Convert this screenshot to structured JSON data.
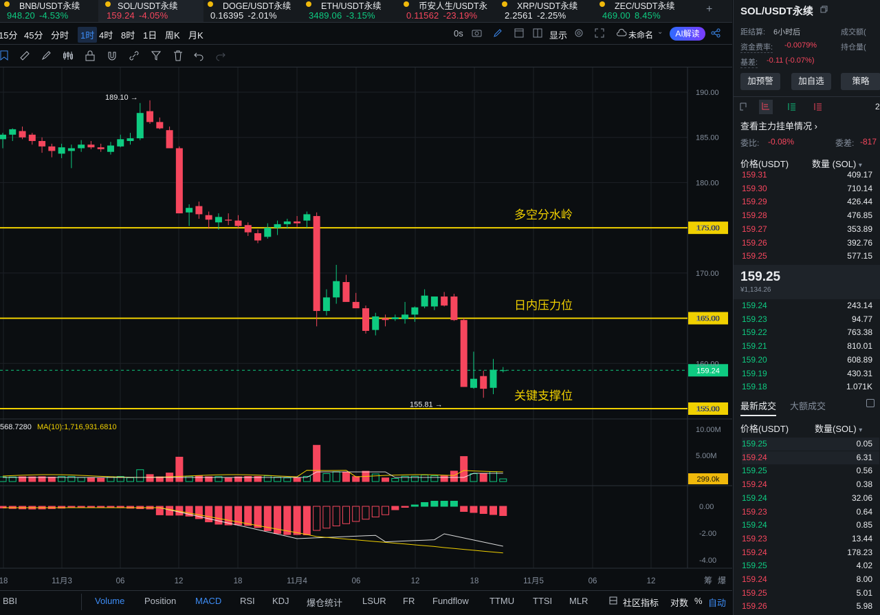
{
  "tickers": [
    {
      "name": "BNB/USDT永续",
      "price": "948.20",
      "change": "-4.53%",
      "dir": "up"
    },
    {
      "name": "SOL/USDT永续",
      "price": "159.24",
      "change": "-4.05%",
      "dir": "dn"
    },
    {
      "name": "DOGE/USDT永续",
      "price": "0.16395",
      "change": "-2.01%",
      "dir": "none"
    },
    {
      "name": "ETH/USDT永续",
      "price": "3489.06",
      "change": "-3.15%",
      "dir": "up"
    },
    {
      "name": "币安人生/USDT永",
      "price": "0.11562",
      "change": "-23.19%",
      "dir": "dn"
    },
    {
      "name": "XRP/USDT永续",
      "price": "2.2561",
      "change": "-2.25%",
      "dir": "none"
    },
    {
      "name": "ZEC/USDT永续",
      "price": "469.00",
      "change": "8.45%",
      "dir": "up"
    }
  ],
  "plus_label": "+",
  "intervals": [
    "15分",
    "45分",
    "分时",
    "1时",
    "4时",
    "8时",
    "1日",
    "周K",
    "月K"
  ],
  "selected_interval": "1时",
  "toolbar1": {
    "zero": "0s",
    "display": "显示",
    "unnamed": "未命名",
    "ai": "AI解读"
  },
  "chart_data": {
    "type": "candlestick",
    "price_axis": [
      "190.00",
      "185.00",
      "180.00",
      "175.00",
      "170.00",
      "165.00",
      "160.00",
      "155.00"
    ],
    "time_axis": [
      "18",
      "11月3",
      "06",
      "12",
      "18",
      "11月4",
      "06",
      "12",
      "18",
      "11月5",
      "06",
      "12"
    ],
    "levels": [
      {
        "price": 175,
        "tag": "175.00",
        "label": "多空分水岭"
      },
      {
        "price": 165,
        "tag": "165.00",
        "label": "日内压力位"
      },
      {
        "price": 155,
        "tag": "155.00",
        "label": "关键支撑位"
      }
    ],
    "last_price": 159.24,
    "last_tag": "159.24",
    "high_mark": {
      "price": 189.1,
      "text": "189.10 →"
    },
    "low_mark": {
      "price": 155.81,
      "text": "155.81 →"
    },
    "candles": [
      [
        184.8,
        185.5,
        183.8,
        185.3
      ],
      [
        185.3,
        186.0,
        184.6,
        185.9
      ],
      [
        185.7,
        186.2,
        184.8,
        185.0
      ],
      [
        185.3,
        185.5,
        184.2,
        184.6
      ],
      [
        184.6,
        185.0,
        183.3,
        184.0
      ],
      [
        184.0,
        184.3,
        182.8,
        183.5
      ],
      [
        183.2,
        184.3,
        182.7,
        183.9
      ],
      [
        183.5,
        184.2,
        181.6,
        183.8
      ],
      [
        183.8,
        184.7,
        183.4,
        184.2
      ],
      [
        184.2,
        184.6,
        183.7,
        183.9
      ],
      [
        183.9,
        184.3,
        183.4,
        183.7
      ],
      [
        183.4,
        184.5,
        183.1,
        184.1
      ],
      [
        184.0,
        185.3,
        183.9,
        184.8
      ],
      [
        184.6,
        185.5,
        184.2,
        184.9
      ],
      [
        184.9,
        188.8,
        184.7,
        187.7
      ],
      [
        187.9,
        189.1,
        186.5,
        186.7
      ],
      [
        186.7,
        187.2,
        185.9,
        186.0
      ],
      [
        185.8,
        186.2,
        183.8,
        183.8
      ],
      [
        183.8,
        184.0,
        176.6,
        176.6
      ],
      [
        176.7,
        177.6,
        175.2,
        177.2
      ],
      [
        177.4,
        177.9,
        176.0,
        176.5
      ],
      [
        176.4,
        176.8,
        174.9,
        175.9
      ],
      [
        175.6,
        176.6,
        174.8,
        176.2
      ],
      [
        175.9,
        176.6,
        175.3,
        175.8
      ],
      [
        175.8,
        176.4,
        174.9,
        175.2
      ],
      [
        175.3,
        175.6,
        174.1,
        174.5
      ],
      [
        174.4,
        174.8,
        173.3,
        173.6
      ],
      [
        174.0,
        175.5,
        173.8,
        175.0
      ],
      [
        175.0,
        175.8,
        174.2,
        175.4
      ],
      [
        175.4,
        176.0,
        174.9,
        175.7
      ],
      [
        175.7,
        176.3,
        175.1,
        175.5
      ],
      [
        175.8,
        176.8,
        175.0,
        176.5
      ],
      [
        176.3,
        176.7,
        164.1,
        165.8
      ],
      [
        165.8,
        168.2,
        165.3,
        167.3
      ],
      [
        167.3,
        170.9,
        166.6,
        169.1
      ],
      [
        169.0,
        169.8,
        166.9,
        166.8
      ],
      [
        166.8,
        167.8,
        166.2,
        166.1
      ],
      [
        166.1,
        166.4,
        163.3,
        163.6
      ],
      [
        163.7,
        165.6,
        163.1,
        165.2
      ],
      [
        165.0,
        165.4,
        164.1,
        164.8
      ],
      [
        164.9,
        165.4,
        164.7,
        165.1
      ],
      [
        164.9,
        166.8,
        164.4,
        165.4
      ],
      [
        165.4,
        166.3,
        164.6,
        166.2
      ],
      [
        166.3,
        168.2,
        166.1,
        167.5
      ],
      [
        166.3,
        167.4,
        165.9,
        167.4
      ],
      [
        167.4,
        167.9,
        166.3,
        166.4
      ],
      [
        167.4,
        167.7,
        164.7,
        164.8
      ],
      [
        164.8,
        165.0,
        157.4,
        157.4
      ],
      [
        157.3,
        161.3,
        157.2,
        158.3
      ],
      [
        158.6,
        159.2,
        156.2,
        157.2
      ],
      [
        157.3,
        160.5,
        156.6,
        159.3
      ],
      [
        159.2,
        159.6,
        159.0,
        159.24
      ]
    ],
    "volume_labels": {
      "left": "568.7280",
      "ma": "MA(10):1,716,931.6810",
      "axis": [
        "10.00M",
        "5.00M"
      ],
      "tag": "299.0k"
    },
    "macd_axis": [
      "0.00",
      "-2.00",
      "-4.00"
    ]
  },
  "bottom_tabs": [
    "BBI",
    "Volume",
    "Position",
    "MACD",
    "RSI",
    "KDJ",
    "爆仓统计",
    "LSUR",
    "FR",
    "Fundflow",
    "TTMU",
    "TTSI",
    "MLR"
  ],
  "bottom_active": [
    "Volume",
    "MACD"
  ],
  "bottom_right": {
    "community": "社区指标",
    "log": "对数",
    "pct": "%",
    "auto": "自动"
  },
  "right_panel": {
    "title": "SOL/USDT永续",
    "settle_label": "距结算:",
    "settle_value": "6小时后",
    "vol_label": "成交额(",
    "funding_label": "资金费率:",
    "funding_value": "-0.0079%",
    "oi_label": "持仓量(",
    "basis_label": "基差:",
    "basis_value": "-0.11 (-0.07%)",
    "buttons": [
      "加预警",
      "加自选",
      "策略"
    ],
    "view_orders": "查看主力挂单情况",
    "ratio_label": "委比:",
    "ratio_value": "-0.08%",
    "diff_label": "委差:",
    "diff_value": "-817",
    "ob_price_header": "价格(USDT)",
    "ob_qty_header": "数量 (SOL)",
    "asks": [
      [
        "159.31",
        "409.17"
      ],
      [
        "159.30",
        "710.14"
      ],
      [
        "159.29",
        "426.44"
      ],
      [
        "159.28",
        "476.85"
      ],
      [
        "159.27",
        "353.89"
      ],
      [
        "159.26",
        "392.76"
      ],
      [
        "159.25",
        "577.15"
      ]
    ],
    "last_price": "159.25",
    "last_cny": "¥1,134.26",
    "bids": [
      [
        "159.24",
        "243.14"
      ],
      [
        "159.23",
        "94.77"
      ],
      [
        "159.22",
        "763.38"
      ],
      [
        "159.21",
        "810.01"
      ],
      [
        "159.20",
        "608.89"
      ],
      [
        "159.19",
        "430.31"
      ],
      [
        "159.18",
        "1.071K"
      ]
    ],
    "tab_latest": "最新成交",
    "tab_big": "大额成交",
    "tr_price_header": "价格(USDT)",
    "tr_qty_header": "数量(SOL)",
    "trades": [
      [
        "159.25",
        "0.05",
        "up"
      ],
      [
        "159.24",
        "6.31",
        "dn"
      ],
      [
        "159.25",
        "0.56",
        "up"
      ],
      [
        "159.24",
        "0.38",
        "dn"
      ],
      [
        "159.24",
        "32.06",
        "up"
      ],
      [
        "159.23",
        "0.64",
        "dn"
      ],
      [
        "159.24",
        "0.85",
        "up"
      ],
      [
        "159.23",
        "13.44",
        "dn"
      ],
      [
        "159.24",
        "178.23",
        "dn"
      ],
      [
        "159.25",
        "4.02",
        "up"
      ],
      [
        "159.24",
        "8.00",
        "dn"
      ],
      [
        "159.25",
        "5.01",
        "dn"
      ],
      [
        "159.26",
        "5.98",
        "dn"
      ]
    ],
    "page_indicator": "2"
  },
  "colors": {
    "up": "#0ecb81",
    "down": "#f6465d",
    "level": "#f0d000",
    "accent": "#3d8cf5",
    "yellowTag": "#f0b90b"
  }
}
